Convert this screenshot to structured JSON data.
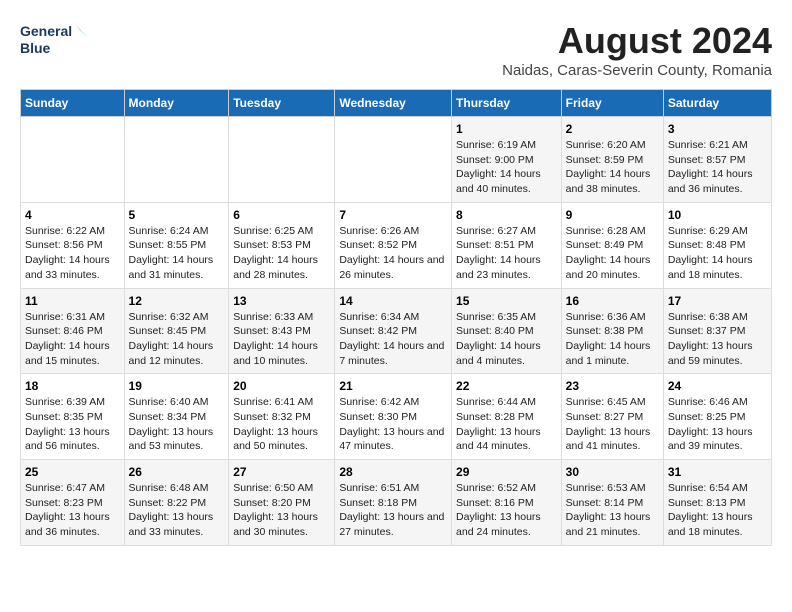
{
  "logo": {
    "line1": "General",
    "line2": "Blue"
  },
  "title": "August 2024",
  "subtitle": "Naidas, Caras-Severin County, Romania",
  "days_of_week": [
    "Sunday",
    "Monday",
    "Tuesday",
    "Wednesday",
    "Thursday",
    "Friday",
    "Saturday"
  ],
  "weeks": [
    [
      {
        "day": "",
        "info": ""
      },
      {
        "day": "",
        "info": ""
      },
      {
        "day": "",
        "info": ""
      },
      {
        "day": "",
        "info": ""
      },
      {
        "day": "1",
        "info": "Sunrise: 6:19 AM\nSunset: 9:00 PM\nDaylight: 14 hours and 40 minutes."
      },
      {
        "day": "2",
        "info": "Sunrise: 6:20 AM\nSunset: 8:59 PM\nDaylight: 14 hours and 38 minutes."
      },
      {
        "day": "3",
        "info": "Sunrise: 6:21 AM\nSunset: 8:57 PM\nDaylight: 14 hours and 36 minutes."
      }
    ],
    [
      {
        "day": "4",
        "info": "Sunrise: 6:22 AM\nSunset: 8:56 PM\nDaylight: 14 hours and 33 minutes."
      },
      {
        "day": "5",
        "info": "Sunrise: 6:24 AM\nSunset: 8:55 PM\nDaylight: 14 hours and 31 minutes."
      },
      {
        "day": "6",
        "info": "Sunrise: 6:25 AM\nSunset: 8:53 PM\nDaylight: 14 hours and 28 minutes."
      },
      {
        "day": "7",
        "info": "Sunrise: 6:26 AM\nSunset: 8:52 PM\nDaylight: 14 hours and 26 minutes."
      },
      {
        "day": "8",
        "info": "Sunrise: 6:27 AM\nSunset: 8:51 PM\nDaylight: 14 hours and 23 minutes."
      },
      {
        "day": "9",
        "info": "Sunrise: 6:28 AM\nSunset: 8:49 PM\nDaylight: 14 hours and 20 minutes."
      },
      {
        "day": "10",
        "info": "Sunrise: 6:29 AM\nSunset: 8:48 PM\nDaylight: 14 hours and 18 minutes."
      }
    ],
    [
      {
        "day": "11",
        "info": "Sunrise: 6:31 AM\nSunset: 8:46 PM\nDaylight: 14 hours and 15 minutes."
      },
      {
        "day": "12",
        "info": "Sunrise: 6:32 AM\nSunset: 8:45 PM\nDaylight: 14 hours and 12 minutes."
      },
      {
        "day": "13",
        "info": "Sunrise: 6:33 AM\nSunset: 8:43 PM\nDaylight: 14 hours and 10 minutes."
      },
      {
        "day": "14",
        "info": "Sunrise: 6:34 AM\nSunset: 8:42 PM\nDaylight: 14 hours and 7 minutes."
      },
      {
        "day": "15",
        "info": "Sunrise: 6:35 AM\nSunset: 8:40 PM\nDaylight: 14 hours and 4 minutes."
      },
      {
        "day": "16",
        "info": "Sunrise: 6:36 AM\nSunset: 8:38 PM\nDaylight: 14 hours and 1 minute."
      },
      {
        "day": "17",
        "info": "Sunrise: 6:38 AM\nSunset: 8:37 PM\nDaylight: 13 hours and 59 minutes."
      }
    ],
    [
      {
        "day": "18",
        "info": "Sunrise: 6:39 AM\nSunset: 8:35 PM\nDaylight: 13 hours and 56 minutes."
      },
      {
        "day": "19",
        "info": "Sunrise: 6:40 AM\nSunset: 8:34 PM\nDaylight: 13 hours and 53 minutes."
      },
      {
        "day": "20",
        "info": "Sunrise: 6:41 AM\nSunset: 8:32 PM\nDaylight: 13 hours and 50 minutes."
      },
      {
        "day": "21",
        "info": "Sunrise: 6:42 AM\nSunset: 8:30 PM\nDaylight: 13 hours and 47 minutes."
      },
      {
        "day": "22",
        "info": "Sunrise: 6:44 AM\nSunset: 8:28 PM\nDaylight: 13 hours and 44 minutes."
      },
      {
        "day": "23",
        "info": "Sunrise: 6:45 AM\nSunset: 8:27 PM\nDaylight: 13 hours and 41 minutes."
      },
      {
        "day": "24",
        "info": "Sunrise: 6:46 AM\nSunset: 8:25 PM\nDaylight: 13 hours and 39 minutes."
      }
    ],
    [
      {
        "day": "25",
        "info": "Sunrise: 6:47 AM\nSunset: 8:23 PM\nDaylight: 13 hours and 36 minutes."
      },
      {
        "day": "26",
        "info": "Sunrise: 6:48 AM\nSunset: 8:22 PM\nDaylight: 13 hours and 33 minutes."
      },
      {
        "day": "27",
        "info": "Sunrise: 6:50 AM\nSunset: 8:20 PM\nDaylight: 13 hours and 30 minutes."
      },
      {
        "day": "28",
        "info": "Sunrise: 6:51 AM\nSunset: 8:18 PM\nDaylight: 13 hours and 27 minutes."
      },
      {
        "day": "29",
        "info": "Sunrise: 6:52 AM\nSunset: 8:16 PM\nDaylight: 13 hours and 24 minutes."
      },
      {
        "day": "30",
        "info": "Sunrise: 6:53 AM\nSunset: 8:14 PM\nDaylight: 13 hours and 21 minutes."
      },
      {
        "day": "31",
        "info": "Sunrise: 6:54 AM\nSunset: 8:13 PM\nDaylight: 13 hours and 18 minutes."
      }
    ]
  ]
}
